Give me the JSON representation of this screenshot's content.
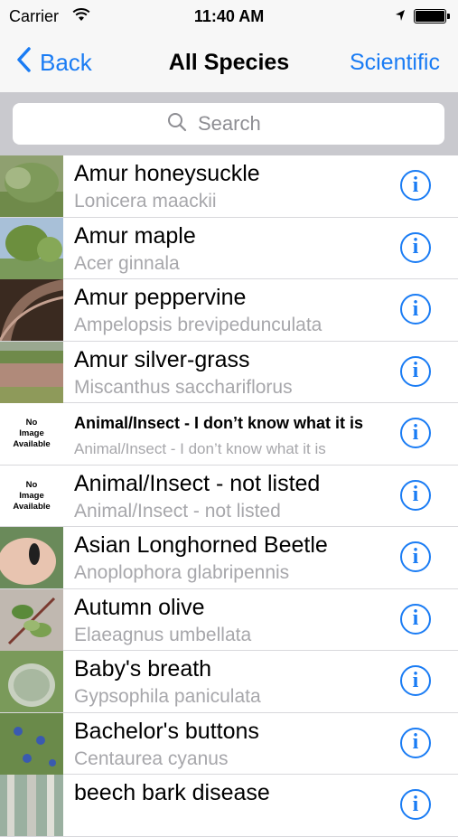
{
  "status": {
    "carrier": "Carrier",
    "time": "11:40 AM"
  },
  "nav": {
    "back_label": "Back",
    "title": "All Species",
    "right_label": "Scientific"
  },
  "search": {
    "placeholder": "Search"
  },
  "colors": {
    "accent": "#1a7cf4",
    "subtitle": "#a7a7ab",
    "search_bg": "#c9c9ce"
  },
  "rows": [
    {
      "common": "Amur honeysuckle",
      "scientific": "Lonicera maackii",
      "image": "photo"
    },
    {
      "common": "Amur maple",
      "scientific": "Acer ginnala",
      "image": "photo"
    },
    {
      "common": "Amur peppervine",
      "scientific": "Ampelopsis brevipedunculata",
      "image": "photo"
    },
    {
      "common": "Amur silver-grass",
      "scientific": "Miscanthus sacchariflorus",
      "image": "photo"
    },
    {
      "common": "Animal/Insect - I don’t know what it is",
      "scientific": "Animal/Insect - I don’t know what it is",
      "image": "none"
    },
    {
      "common": "Animal/Insect - not listed",
      "scientific": "Animal/Insect - not listed",
      "image": "none"
    },
    {
      "common": "Asian Longhorned Beetle",
      "scientific": "Anoplophora glabripennis",
      "image": "photo"
    },
    {
      "common": "Autumn olive",
      "scientific": "Elaeagnus umbellata",
      "image": "photo"
    },
    {
      "common": "Baby's breath",
      "scientific": "Gypsophila paniculata",
      "image": "photo"
    },
    {
      "common": "Bachelor's buttons",
      "scientific": "Centaurea cyanus",
      "image": "photo"
    },
    {
      "common": "beech bark disease",
      "scientific": "",
      "image": "photo"
    }
  ],
  "no_image": {
    "line1": "No",
    "line2": "Image",
    "line3": "Available"
  },
  "info_glyph": "i"
}
